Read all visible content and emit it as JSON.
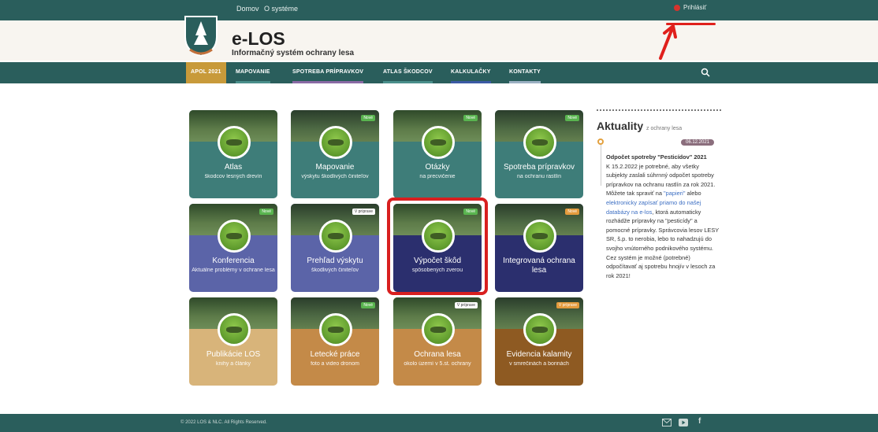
{
  "topbar": {
    "home": "Domov",
    "about": "O systéme",
    "login": "Prihlásiť"
  },
  "brand": {
    "name": "e-LOS",
    "tagline": "Informačný systém ochrany lesa"
  },
  "nav": {
    "items": [
      {
        "label": "APOL 2021",
        "accent": "#c89a3a"
      },
      {
        "label": "MAPOVANIE",
        "accent": "#4a8f8b"
      },
      {
        "label": "SPOTREBA PRÍPRAVKOV",
        "accent": "#8a6aa5"
      },
      {
        "label": "ATLAS ŠKODCOV",
        "accent": "#4a8f8b"
      },
      {
        "label": "KALKULAČKY",
        "accent": "#3b5aa5"
      },
      {
        "label": "KONTAKTY",
        "accent": "#9bb0c2"
      }
    ],
    "search_icon": "search-icon"
  },
  "tiles": [
    {
      "title": "Atlas",
      "sub": "škodcov lesných drevín",
      "color": "#3e7d79",
      "badge": ""
    },
    {
      "title": "Mapovanie",
      "sub": "výskytu škodlivých činiteľov",
      "color": "#3e7d79",
      "badge": "Nové"
    },
    {
      "title": "Otázky",
      "sub": "na precvičenie",
      "color": "#3e7d79",
      "badge": "Nové"
    },
    {
      "title": "Spotreba prípravkov",
      "sub": "na ochranu rastlín",
      "color": "#3e7d79",
      "badge": "Nové"
    },
    {
      "title": "Konferencia",
      "sub": "Aktuálne problémy v ochrane lesa",
      "color": "#5b64a8",
      "badge": "Nové"
    },
    {
      "title": "Prehľad výskytu",
      "sub": "škodlivých činiteľov",
      "color": "#5b64a8",
      "badge": "V príprave"
    },
    {
      "title": "Výpočet škôd",
      "sub": "spôsobených zverou",
      "color": "#2b2f6e",
      "badge": "Nové"
    },
    {
      "title": "Integrovaná ochrana lesa",
      "sub": "",
      "color": "#2b2f6e",
      "badge": "Nové"
    },
    {
      "title": "Publikácie LOS",
      "sub": "knihy a články",
      "color": "#d8b47a",
      "badge": ""
    },
    {
      "title": "Letecké práce",
      "sub": "foto a video dronom",
      "color": "#c48a48",
      "badge": "Nové"
    },
    {
      "title": "Ochrana lesa",
      "sub": "okolo území v 5.st. ochrany",
      "color": "#c48a48",
      "badge": "V príprave"
    },
    {
      "title": "Evidencia kalamity",
      "sub": "v smrečinách a borinách",
      "color": "#8e5a22",
      "badge": "V príprave"
    }
  ],
  "news": {
    "heading": "Aktuality",
    "heading_sub": "z ochrany lesa",
    "date": "06.12.2021",
    "title": "Odpočet spotreby \"Pesticídov\" 2021",
    "body1": "K 15.2.2022 je potrebné, aby všetky subjekty zaslali súhrnný odpočet spotreby prípravkov na ochranu rastlín za rok 2021. Môžete tak spraviť na ",
    "link_paper": "\"papieri\"",
    "body2": " alebo ",
    "link_online": "elektronicky zapísať priamo do našej databázy na e-los",
    "body3": ", ktorá automaticky rozhádže prípravky na \"pesticídy\" a pomocné prípravky. Správcovia lesov LESY SR, š.p. to nerobia, lebo to nahadzujú do svojho vnútorného podnikového systému. Cez systém je možné (potrebné) odpočítavať aj spotrebu hnojív v lesoch za rok 2021!"
  },
  "footer": {
    "copy": "© 2022 LOS & NLC. All Rights Reserved.",
    "mail_icon": "mail-icon",
    "youtube_icon": "youtube-icon",
    "facebook_icon": "facebook-icon"
  }
}
